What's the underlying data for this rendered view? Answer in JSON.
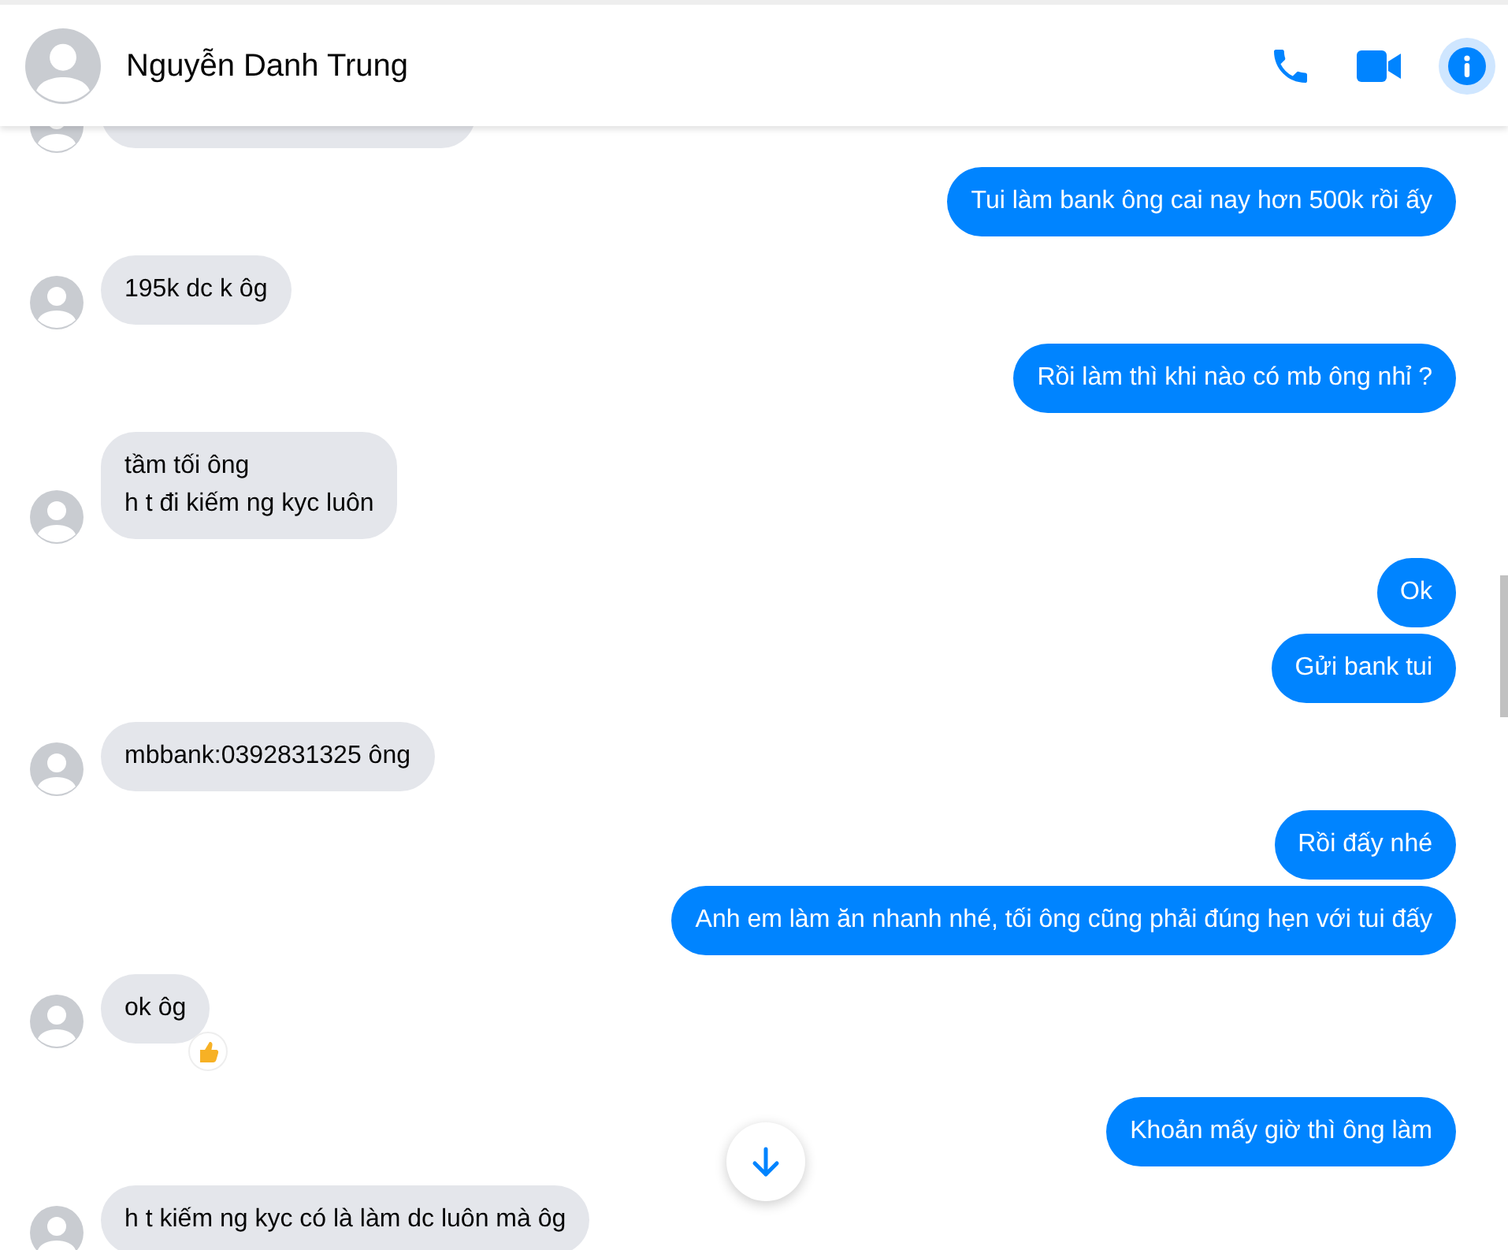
{
  "header": {
    "name": "Nguyễn Danh Trung",
    "info_active": true
  },
  "groups": [
    {
      "kind": "incoming_cut"
    },
    {
      "kind": "outgoing",
      "messages": [
        {
          "text": "Tui làm bank ông cai nay hơn 500k rồi ấy"
        }
      ]
    },
    {
      "kind": "incoming",
      "messages": [
        {
          "text": "195k dc k ôg"
        }
      ]
    },
    {
      "kind": "outgoing",
      "messages": [
        {
          "text": "Rồi làm thì khi nào có mb ông nhỉ ?"
        }
      ]
    },
    {
      "kind": "incoming",
      "messages": [
        {
          "text": "tầm tối ông\nh t đi kiếm ng kyc luôn"
        }
      ]
    },
    {
      "kind": "outgoing",
      "messages": [
        {
          "text": "Ok"
        },
        {
          "text": "Gửi bank tui"
        }
      ]
    },
    {
      "kind": "incoming",
      "messages": [
        {
          "text": "mbbank:0392831325 ông"
        }
      ]
    },
    {
      "kind": "outgoing",
      "messages": [
        {
          "text": "Rồi đấy nhé"
        },
        {
          "text": "Anh em làm ăn nhanh nhé, tối ông cũng phải đúng hẹn với tui đấy"
        }
      ]
    },
    {
      "kind": "incoming",
      "messages": [
        {
          "text": "ok ôg",
          "liked": true
        }
      ]
    },
    {
      "kind": "outgoing",
      "messages": [
        {
          "text": "Khoản mấy giờ thì ông làm"
        }
      ]
    },
    {
      "kind": "incoming",
      "messages": [
        {
          "text": "h t kiếm ng kyc có là làm dc luôn mà ôg"
        }
      ]
    }
  ]
}
